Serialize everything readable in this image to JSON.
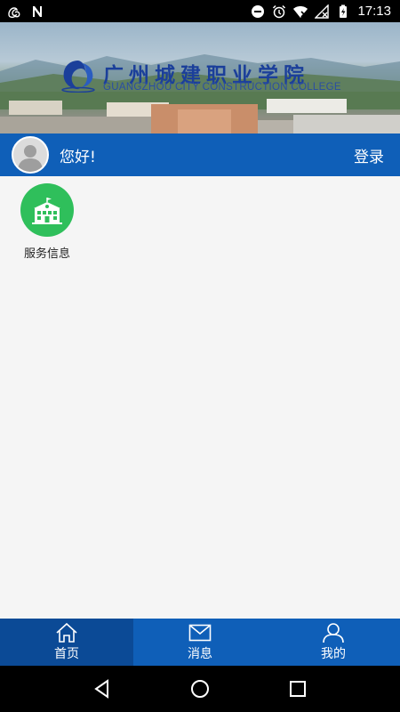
{
  "status_bar": {
    "time": "17:13",
    "left_icons": [
      "uc-browser-icon",
      "n-notification-icon"
    ],
    "right_icons": [
      "do-not-disturb-icon",
      "alarm-icon",
      "wifi-icon",
      "no-signal-icon",
      "battery-charging-icon"
    ]
  },
  "banner": {
    "title": "广州城建职业学院",
    "subtitle": "GUANGZHOU CITY CONSTRUCTION COLLEGE"
  },
  "user_bar": {
    "greeting": "您好!",
    "login_label": "登录"
  },
  "apps": [
    {
      "label": "服务信息",
      "icon": "school-building-icon",
      "color": "#2fbf5b"
    }
  ],
  "bottom_nav": {
    "items": [
      {
        "label": "首页",
        "icon": "home-icon",
        "active": true
      },
      {
        "label": "消息",
        "icon": "mail-icon",
        "active": false
      },
      {
        "label": "我的",
        "icon": "user-icon",
        "active": false
      }
    ]
  },
  "colors": {
    "primary": "#0f5fb8",
    "primary_dark": "#0b4a96",
    "app_green": "#2fbf5b"
  }
}
